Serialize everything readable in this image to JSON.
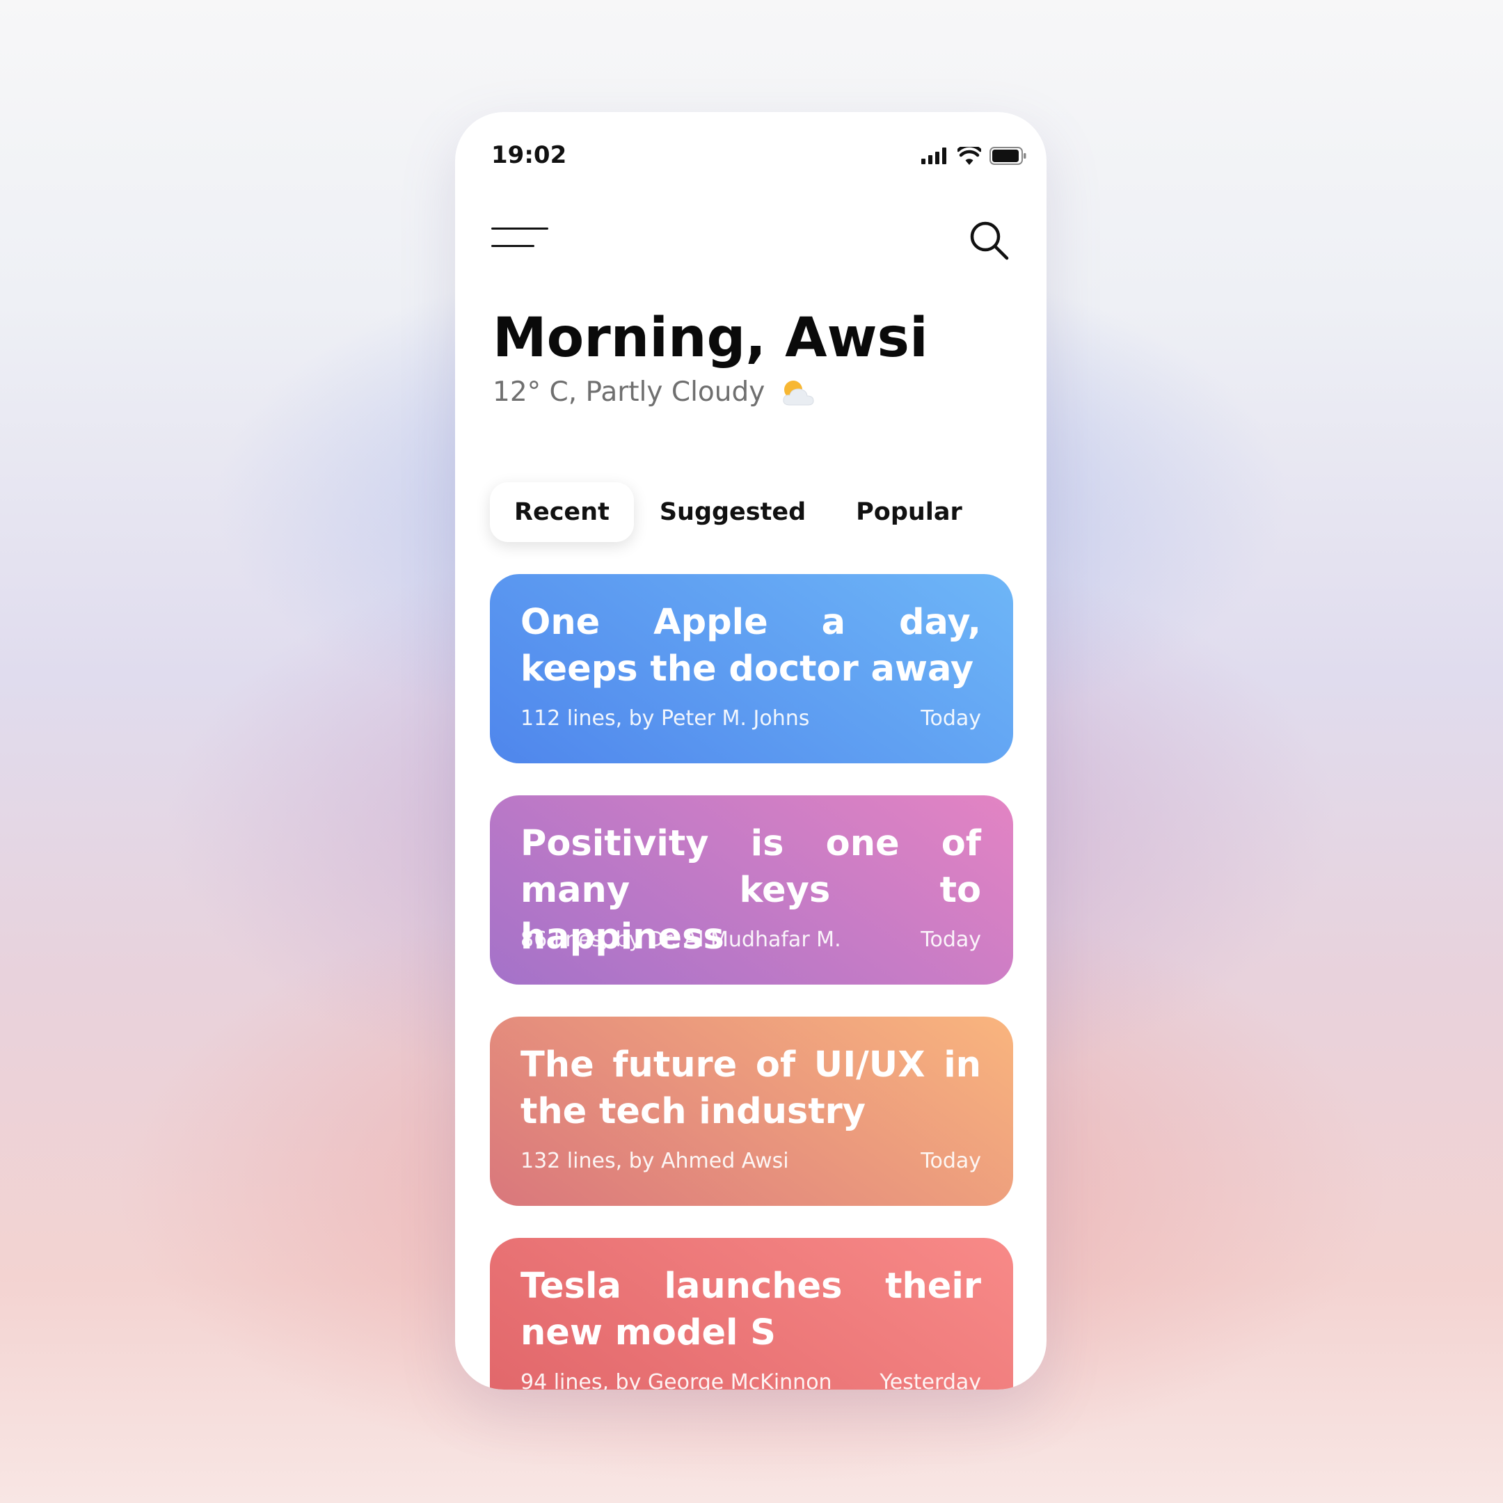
{
  "status_bar": {
    "time": "19:02"
  },
  "header": {
    "menu_icon": "hamburger-menu-icon",
    "search_icon": "search-icon"
  },
  "greeting": {
    "title": "Morning, Awsi",
    "weather": "12° C, Partly Cloudy",
    "weather_icon": "partly-cloudy-icon"
  },
  "tabs": [
    {
      "label": "Recent",
      "active": true
    },
    {
      "label": "Suggested",
      "active": false
    },
    {
      "label": "Popular",
      "active": false
    }
  ],
  "articles": [
    {
      "title": "One Apple a day, keeps the doctor away",
      "meta": "112 lines, by Peter M. Johns",
      "date": "Today",
      "gradient": [
        "#4f86ec",
        "#6eb6f7"
      ]
    },
    {
      "title": "Positivity is one of many keys to happiness",
      "meta": "86 lines, by Dr. Al Mudhafar M.",
      "date": "Today",
      "gradient": [
        "#a472c9",
        "#e384c3"
      ]
    },
    {
      "title": "The future of UI/UX in the tech industry",
      "meta": "132 lines, by Ahmed Awsi",
      "date": "Today",
      "gradient": [
        "#d9777c",
        "#f9b57e"
      ]
    },
    {
      "title": "Tesla launches their new model S",
      "meta": "94 lines, by George McKinnon",
      "date": "Yesterday",
      "gradient": [
        "#e06569",
        "#f88a88"
      ]
    }
  ]
}
